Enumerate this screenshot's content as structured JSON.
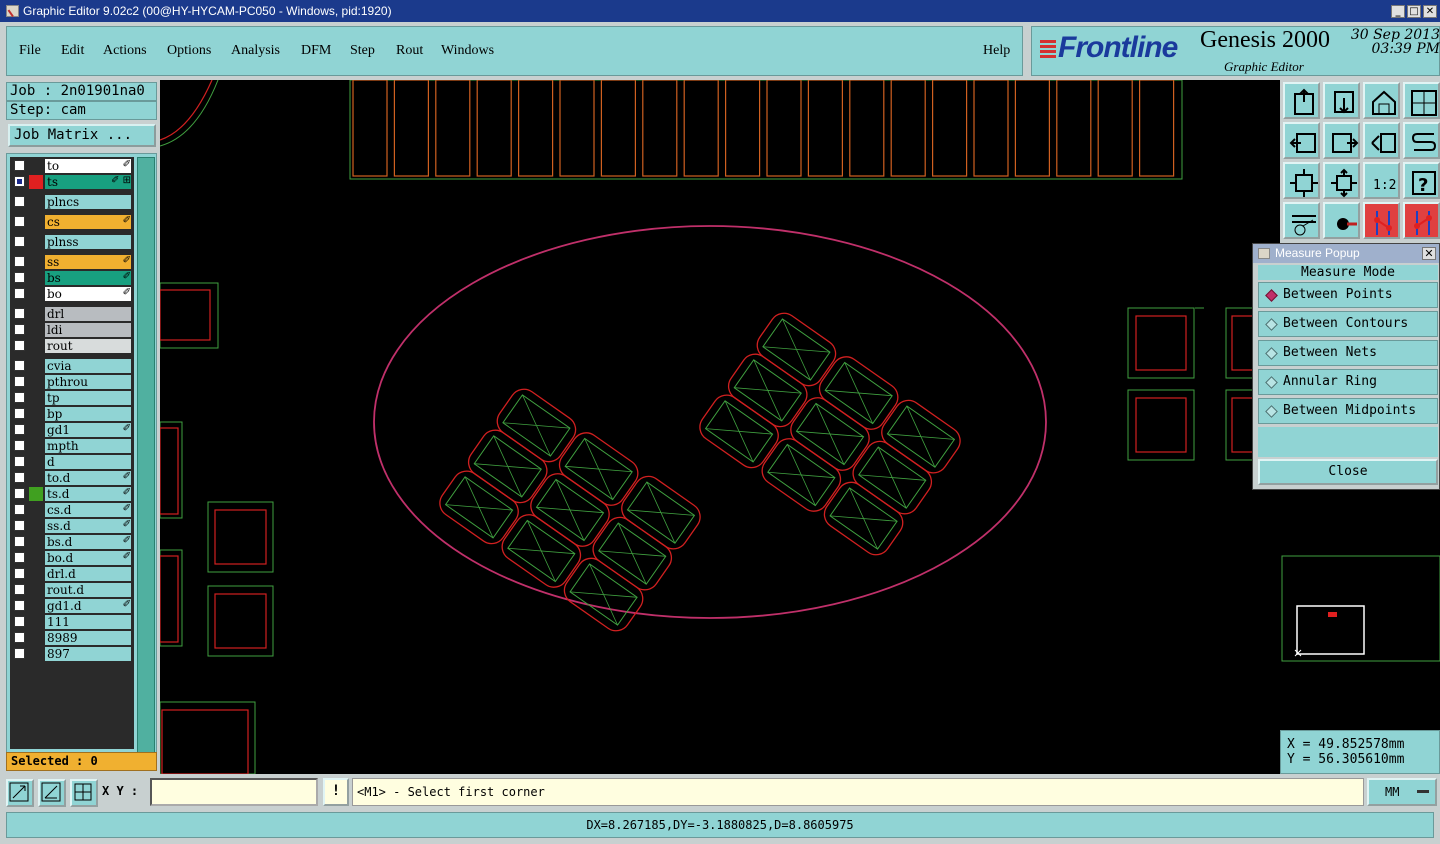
{
  "window": {
    "title": "Graphic Editor 9.02c2 (00@HY-HYCAM-PC050 - Windows, pid:1920)"
  },
  "menu": {
    "items": [
      "File",
      "Edit",
      "Actions",
      "Options",
      "Analysis",
      "DFM",
      "Step",
      "Rout",
      "Windows"
    ],
    "help": "Help"
  },
  "brand": {
    "logo": "Frontline",
    "product": "Genesis 2000",
    "subtitle": "Graphic Editor",
    "date": "30 Sep 2013",
    "time": "03:39 PM"
  },
  "job": {
    "job_label": "Job : 2n01901na0",
    "step_label": "Step: cam",
    "matrix_button": "Job Matrix ..."
  },
  "layers": [
    {
      "name": "to",
      "color": "#ffffff",
      "side": "",
      "mark": "✐",
      "checked": false
    },
    {
      "name": "ts",
      "color": "#18a080",
      "side": "#e02020",
      "mark": "✐ ⊞",
      "checked": true
    },
    {
      "name": "plncs",
      "color": "#90d4d4",
      "side": "",
      "mark": "",
      "checked": false,
      "gap": true
    },
    {
      "name": "cs",
      "color": "#f0b030",
      "side": "",
      "mark": "✐",
      "checked": false,
      "gap": true
    },
    {
      "name": "plnss",
      "color": "#90d4d4",
      "side": "",
      "mark": "",
      "checked": false,
      "gap": true
    },
    {
      "name": "ss",
      "color": "#f0b030",
      "side": "",
      "mark": "✐",
      "checked": false,
      "gap": true
    },
    {
      "name": "bs",
      "color": "#18a080",
      "side": "",
      "mark": "✐",
      "checked": false
    },
    {
      "name": "bo",
      "color": "#ffffff",
      "side": "",
      "mark": "✐",
      "checked": false
    },
    {
      "name": "drl",
      "color": "#b8bcc0",
      "side": "",
      "mark": "",
      "checked": false,
      "gap": true
    },
    {
      "name": "ldi",
      "color": "#b8bcc0",
      "side": "",
      "mark": "",
      "checked": false
    },
    {
      "name": "rout",
      "color": "#d8dcdc",
      "side": "",
      "mark": "",
      "checked": false
    },
    {
      "name": "cvia",
      "color": "#90d4d4",
      "side": "",
      "mark": "",
      "checked": false,
      "gap": true
    },
    {
      "name": "pthrou",
      "color": "#90d4d4",
      "side": "",
      "mark": "",
      "checked": false
    },
    {
      "name": "tp",
      "color": "#90d4d4",
      "side": "",
      "mark": "",
      "checked": false
    },
    {
      "name": "bp",
      "color": "#90d4d4",
      "side": "",
      "mark": "",
      "checked": false
    },
    {
      "name": "gd1",
      "color": "#90d4d4",
      "side": "",
      "mark": "✐",
      "checked": false
    },
    {
      "name": "mpth",
      "color": "#90d4d4",
      "side": "",
      "mark": "",
      "checked": false
    },
    {
      "name": "d",
      "color": "#90d4d4",
      "side": "",
      "mark": "",
      "checked": false
    },
    {
      "name": "to.d",
      "color": "#90d4d4",
      "side": "",
      "mark": "✐",
      "checked": false
    },
    {
      "name": "ts.d",
      "color": "#90d4d4",
      "side": "#40a020",
      "mark": "✐",
      "checked": false
    },
    {
      "name": "cs.d",
      "color": "#90d4d4",
      "side": "",
      "mark": "✐",
      "checked": false
    },
    {
      "name": "ss.d",
      "color": "#90d4d4",
      "side": "",
      "mark": "✐",
      "checked": false
    },
    {
      "name": "bs.d",
      "color": "#90d4d4",
      "side": "",
      "mark": "✐",
      "checked": false
    },
    {
      "name": "bo.d",
      "color": "#90d4d4",
      "side": "",
      "mark": "✐",
      "checked": false
    },
    {
      "name": "drl.d",
      "color": "#90d4d4",
      "side": "",
      "mark": "",
      "checked": false
    },
    {
      "name": "rout.d",
      "color": "#90d4d4",
      "side": "",
      "mark": "",
      "checked": false
    },
    {
      "name": "gd1.d",
      "color": "#90d4d4",
      "side": "",
      "mark": "✐",
      "checked": false
    },
    {
      "name": "111",
      "color": "#90d4d4",
      "side": "",
      "mark": "",
      "checked": false
    },
    {
      "name": "8989",
      "color": "#90d4d4",
      "side": "",
      "mark": "",
      "checked": false
    },
    {
      "name": "897",
      "color": "#90d4d4",
      "side": "",
      "mark": "",
      "checked": false
    }
  ],
  "selected": "Selected : 0",
  "tools": [
    "zoom-home-icon",
    "zoom-down-icon",
    "home-icon",
    "window-icon",
    "pan-left-icon",
    "pan-right-icon",
    "undo-zoom-icon",
    "redraw-icon",
    "fit-icon",
    "center-icon",
    "one-to-one-icon",
    "help-icon",
    "settings-icon",
    "snap-icon",
    "layer-compare-icon",
    "layer-compare-2-icon"
  ],
  "tool_text": {
    "one_to_one": "1:2",
    "help": "?"
  },
  "measure": {
    "title": "Measure Popup",
    "close_x": "✕",
    "header": "Measure Mode",
    "modes": [
      "Between Points",
      "Between Contours",
      "Between Nets",
      "Annular Ring",
      "Between Midpoints"
    ],
    "selected_index": 0,
    "close": "Close"
  },
  "coords": {
    "x": "X = 49.852578mm",
    "y": "Y = 56.305610mm"
  },
  "command": {
    "xy_label": "X Y :",
    "xy_value": "",
    "bang": "!",
    "prompt": "<M1> - Select first corner",
    "unit": "MM"
  },
  "status": "DX=8.267185,DY=-3.1880825,D=8.8605975",
  "colors": {
    "panel": "#90d4d4",
    "canvas": "#000000",
    "outline": "#c0306a",
    "pad_red": "#d02020",
    "pad_green": "#40a040"
  }
}
